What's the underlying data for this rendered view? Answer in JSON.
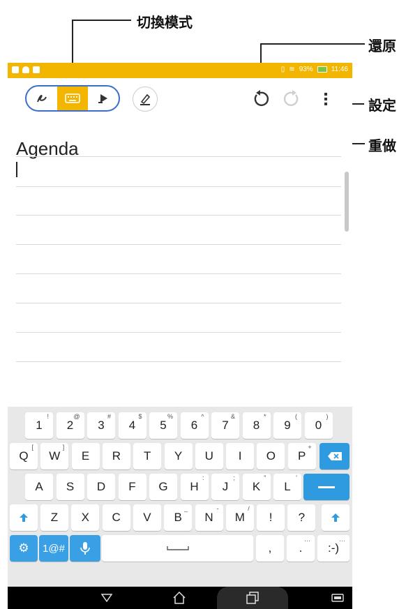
{
  "callouts": {
    "switch_mode": "切換模式",
    "undo": "還原",
    "settings": "設定",
    "redo": "重做"
  },
  "status_bar": {
    "battery": "93%",
    "time": "11:46",
    "bg_color": "#f3b600"
  },
  "toolbar": {
    "modes": [
      "handwriting-icon",
      "keyboard-icon",
      "highlighter-icon"
    ],
    "active_mode": "keyboard-icon",
    "extra": [
      "pen-style-icon"
    ],
    "actions": [
      "undo-icon",
      "redo-icon",
      "more-vert-icon"
    ],
    "accent": "#3c6ec9"
  },
  "editor": {
    "title": "Agenda"
  },
  "keyboard": {
    "row1": [
      {
        "k": "1",
        "s": "!"
      },
      {
        "k": "2",
        "s": "@"
      },
      {
        "k": "3",
        "s": "#"
      },
      {
        "k": "4",
        "s": "$"
      },
      {
        "k": "5",
        "s": "%"
      },
      {
        "k": "6",
        "s": "^"
      },
      {
        "k": "7",
        "s": "&"
      },
      {
        "k": "8",
        "s": "*"
      },
      {
        "k": "9",
        "s": "("
      },
      {
        "k": "0",
        "s": ")"
      }
    ],
    "row2": [
      {
        "k": "Q",
        "s": "["
      },
      {
        "k": "W",
        "s": "]"
      },
      {
        "k": "E",
        "s": ""
      },
      {
        "k": "R",
        "s": ""
      },
      {
        "k": "T",
        "s": ""
      },
      {
        "k": "Y",
        "s": ""
      },
      {
        "k": "U",
        "s": ""
      },
      {
        "k": "I",
        "s": ""
      },
      {
        "k": "O",
        "s": ""
      },
      {
        "k": "P",
        "s": "+"
      }
    ],
    "row3": [
      {
        "k": "A",
        "s": ""
      },
      {
        "k": "S",
        "s": ""
      },
      {
        "k": "D",
        "s": ""
      },
      {
        "k": "F",
        "s": ""
      },
      {
        "k": "G",
        "s": ""
      },
      {
        "k": "H",
        "s": ":"
      },
      {
        "k": "J",
        "s": ";"
      },
      {
        "k": "K",
        "s": "\""
      },
      {
        "k": "L",
        "s": "'"
      }
    ],
    "row4": [
      {
        "k": "Z",
        "s": ""
      },
      {
        "k": "X",
        "s": ""
      },
      {
        "k": "C",
        "s": ""
      },
      {
        "k": "V",
        "s": ""
      },
      {
        "k": "B",
        "s": "_"
      },
      {
        "k": "N",
        "s": "-"
      },
      {
        "k": "M",
        "s": "/"
      },
      {
        "k": "!",
        "s": ""
      },
      {
        "k": "?",
        "s": ""
      }
    ],
    "symbols_key": "1@#",
    "comma": ",",
    "period": ".",
    "emoticon": ":-)",
    "key_accent": "#2e9be0"
  }
}
